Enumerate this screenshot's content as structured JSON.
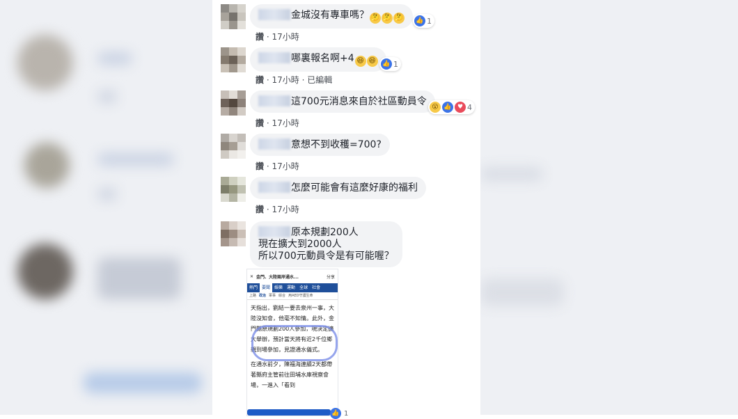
{
  "comments": [
    {
      "text": "金城沒有專車嗎？",
      "emojis": [
        "🤔",
        "🤔",
        "🤔"
      ],
      "reaction_count": "1",
      "meta": {
        "like": "讚",
        "sep": "·",
        "time": "17小時",
        "extra": ""
      }
    },
    {
      "text": "哪裏報名啊+4",
      "emojis": [
        "😆",
        "😆"
      ],
      "reaction_count": "1",
      "meta": {
        "like": "讚",
        "sep": "·",
        "time": "17小時",
        "extra": "· 已編輯"
      }
    },
    {
      "text": "這700元消息來自於社區動員令",
      "emojis": [],
      "reaction_count": "4",
      "meta": {
        "like": "讚",
        "sep": "·",
        "time": "17小時",
        "extra": ""
      }
    },
    {
      "text": "意想不到收穫=700?",
      "emojis": [],
      "reaction_count": "",
      "meta": {
        "like": "讚",
        "sep": "·",
        "time": "17小時",
        "extra": ""
      }
    },
    {
      "text": "怎麼可能會有這麼好康的福利",
      "emojis": [],
      "reaction_count": "",
      "meta": {
        "like": "讚",
        "sep": "·",
        "time": "17小時",
        "extra": ""
      }
    },
    {
      "lines": [
        "原本規劃200人",
        "現在擴大到2000人",
        "所以700元動員令是有可能喔？"
      ]
    }
  ],
  "embedded_screenshot": {
    "top_title": "金門、大陸兩岸通水...",
    "top_action": "分享",
    "nav": [
      "熱門",
      "要聞",
      "娛樂",
      "運動",
      "全球",
      "社會"
    ],
    "nav_active": "要聞",
    "sub_nav": [
      "上路",
      "政治",
      "軍事",
      "綜合",
      "用AED守護生命"
    ],
    "paragraph1": "天指出，劉結一要去泉州一事，大陸沒知會，他毫不知情。此外，金門縣原規劃200人參加，現決定擴大舉辦，預計當天將有近2千位鄉親到場參加，見證通水儀式。",
    "paragraph2": "在通水前夕，陳福海連續2天都帶著縣府主管前往田埔水庫視察會場，一進入「看到",
    "reaction_count": "1"
  },
  "colors": {
    "like_blue": "#3b73e8",
    "bubble_bg": "#f2f3f5",
    "nav_blue": "#1f4f9a"
  }
}
